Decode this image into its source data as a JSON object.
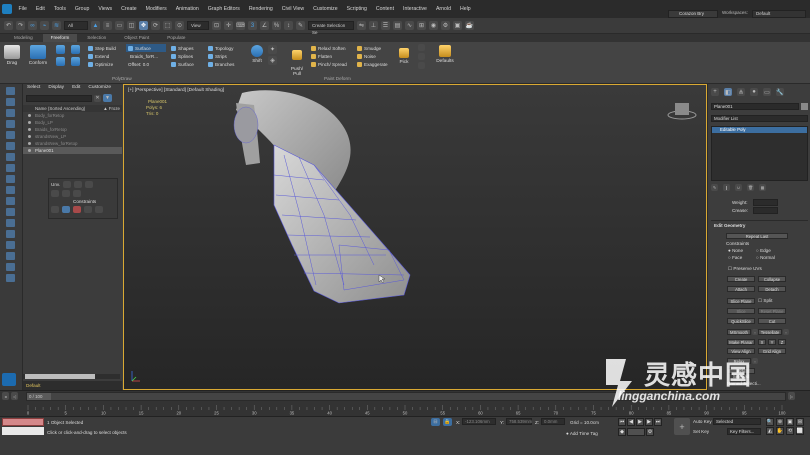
{
  "menubar": {
    "items": [
      "File",
      "Edit",
      "Tools",
      "Group",
      "Views",
      "Create",
      "Modifiers",
      "Animation",
      "Graph Editors",
      "Rendering",
      "Civil View",
      "Customize",
      "Scripting",
      "Content",
      "Interactive",
      "Arnold",
      "Help"
    ],
    "user": "Corazon Bry",
    "workspaces_label": "Workspaces:",
    "workspace_value": "Default"
  },
  "toolbar": {
    "selection_filter": "All",
    "ref_coord": "View",
    "create_selection_set": "Create Selection Se"
  },
  "ribbon_tabs": [
    "Modeling",
    "Freeform",
    "Selection",
    "Object Paint",
    "Populate"
  ],
  "ribbon": {
    "drag": "Drag",
    "conform": "Conform",
    "step_build": "Step Build",
    "extend": "Extend",
    "optimize": "Optimize",
    "surface": "Surface",
    "draw_on": "Braids_forR...",
    "offset": "Offset: 0.0",
    "shapes": "Shapes",
    "splines": "Splines",
    "surface2": "Surface",
    "topology": "Topology",
    "strips": "Strips",
    "branches": "Branches",
    "shift": "Shift",
    "push_pull": "Push/\nPull",
    "relax_soften": "Relax/ Soften",
    "flatten": "Flatten",
    "pinch_spread": "Pinch/ Spread",
    "smudge": "Smudge",
    "noise": "Noise",
    "exaggerate": "Exaggerate",
    "pick": "Pick",
    "defaults": "Defaults",
    "group_polydraw": "PolyDraw",
    "group_paint_deform": "Paint Deform"
  },
  "explorer": {
    "menu": [
      "Select",
      "Display",
      "Edit",
      "Customize"
    ],
    "header": "Name (Sorted Ascending)",
    "header_right": "▲ Froze",
    "rows": [
      "Body_forRetop",
      "Body_LP",
      "Braids_forRetop",
      "strandsNew_LP",
      "strandsNew_forRetop",
      "Plane001"
    ],
    "layer": "Default"
  },
  "unwrap_panel": {
    "title": "Unv.",
    "constraints": "Constraints"
  },
  "viewport": {
    "label": "[+] [Perspective] [Standard] [Default Shading]",
    "object_name": "Plane001",
    "polys_label": "Polys:",
    "polys_value": "6",
    "tris_label": "Tris:",
    "tris_value": "0"
  },
  "command_panel": {
    "object_name": "Plane001",
    "modifier_list": "Modifier List",
    "stack_item": "Editable Poly",
    "weight": "Weight:",
    "crease": "Crease:",
    "rollout": "Edit Geometry",
    "repeat_last": "Repeat Last",
    "constraints": "Constraints",
    "c_none": "None",
    "c_edge": "Edge",
    "c_face": "Face",
    "c_normal": "Normal",
    "preserve_uvs": "Preserve UVs",
    "create": "Create",
    "collapse": "Collapse",
    "attach": "Attach",
    "detach": "Detach",
    "slice_plane": "Slice Plane",
    "split": "Split",
    "slice": "Slice",
    "reset_plane": "Reset Plane",
    "quickslice": "QuickSlice",
    "cut": "Cut",
    "msmooth": "MSmooth",
    "tessellate": "Tessellate",
    "make_planar": "Make Planar",
    "x": "X",
    "y": "Y",
    "z": "Z",
    "view_align": "View Align",
    "grid_align": "Grid Align",
    "relax": "Relax",
    "hide_selected": "Hide Selected",
    "named_selections": "Named Selecti..."
  },
  "timeline": {
    "frame": "0 / 100",
    "ticks": [
      "0",
      "5",
      "10",
      "15",
      "20",
      "25",
      "30",
      "35",
      "40",
      "45",
      "50",
      "55",
      "60",
      "65",
      "70",
      "75",
      "80",
      "85",
      "90",
      "95",
      "100"
    ]
  },
  "status": {
    "selected": "1 Object Selected",
    "prompt": "Click or click-and-drag to select objects",
    "x_label": "X:",
    "x_value": "-123.106mm",
    "y_label": "Y:",
    "y_value": "758.539mm",
    "z_label": "Z:",
    "z_value": "0.0mm",
    "grid": "Grid = 10.0cm",
    "add_time_tag": "Add Time Tag",
    "auto_key": "Auto Key",
    "set_key": "Set Key",
    "selected_dd": "Selected",
    "key_filters": "Key Filters..."
  },
  "watermark": {
    "cn": "灵感中国",
    "url": "lingganchina.com"
  }
}
